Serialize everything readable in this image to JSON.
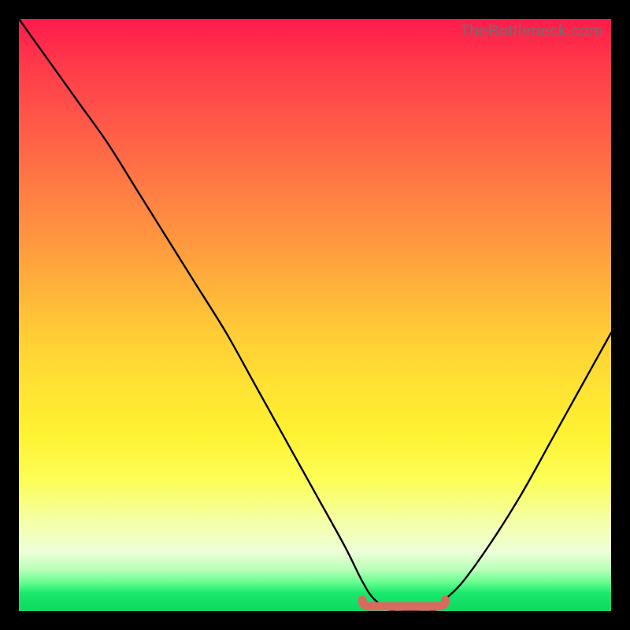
{
  "watermark": "TheBottleneck.com",
  "colors": {
    "frame": "#000000",
    "curve": "#000000",
    "marker": "#d96a5f",
    "watermark": "#6f6f6f"
  },
  "chart_data": {
    "type": "line",
    "title": "",
    "xlabel": "",
    "ylabel": "",
    "xlim": [
      0,
      100
    ],
    "ylim": [
      0,
      100
    ],
    "grid": false,
    "series": [
      {
        "name": "bottleneck-curve",
        "x": [
          0,
          5,
          10,
          15,
          20,
          25,
          30,
          35,
          40,
          45,
          50,
          55,
          58,
          60,
          63,
          66,
          70,
          72,
          75,
          80,
          85,
          90,
          95,
          100
        ],
        "values": [
          100,
          93,
          86,
          79,
          71,
          63,
          55,
          47,
          38,
          29,
          20,
          11,
          5,
          2,
          0,
          0,
          0,
          2,
          5,
          12,
          20,
          29,
          38,
          47
        ]
      }
    ],
    "annotations": [
      {
        "name": "minimum-marker",
        "x_start": 58,
        "x_end": 72,
        "y": 0
      }
    ]
  }
}
